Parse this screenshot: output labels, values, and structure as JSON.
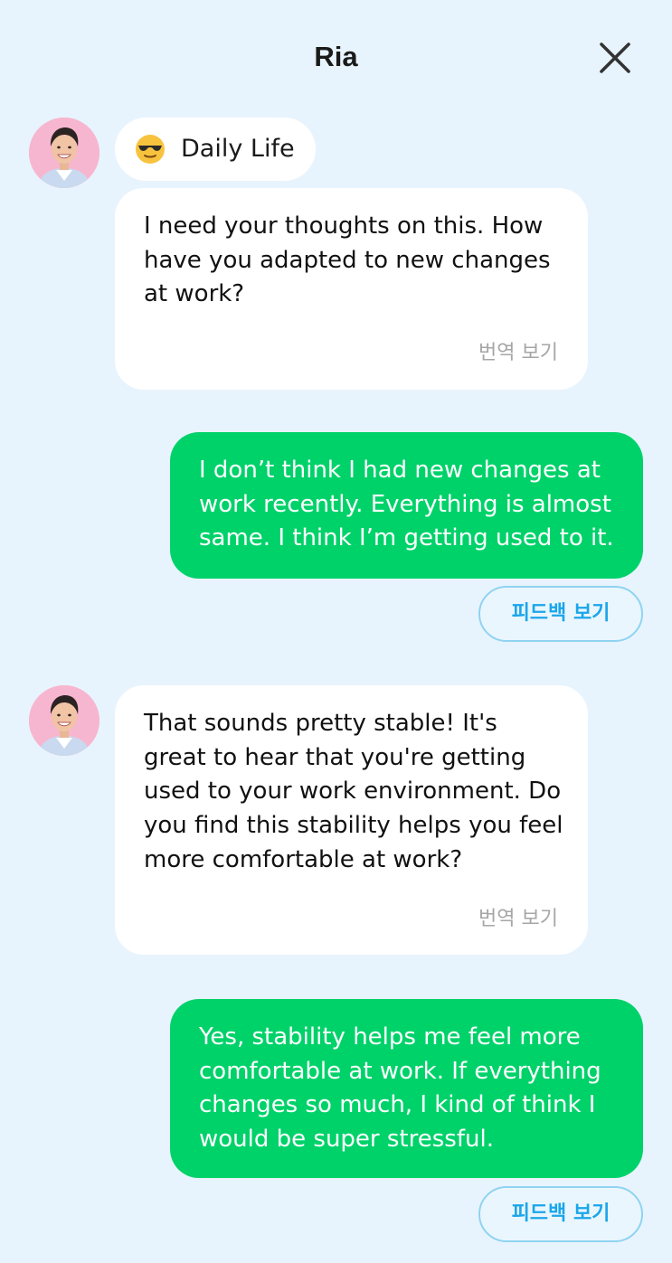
{
  "header": {
    "title": "Ria"
  },
  "topic": {
    "emoji": "😎",
    "label": "Daily Life"
  },
  "messages": [
    {
      "sender": "ai",
      "text": "I need your thoughts on this. How\nhave you adapted to new changes\nat work?",
      "translate_label": "번역 보기"
    },
    {
      "sender": "user",
      "text": "I don’t think I had new changes at\nwork recently. Everything is almost\nsame. I think I’m getting used to it.",
      "feedback_label": "피드백 보기"
    },
    {
      "sender": "ai",
      "text": "That sounds pretty stable! It's\ngreat to hear that you're getting\nused to your work environment. Do\nyou find this stability helps you feel\nmore comfortable at work?",
      "translate_label": "번역 보기"
    },
    {
      "sender": "user",
      "text": "Yes, stability helps me feel more\ncomfortable at work. If everything\nchanges so much, I kind of think I\nwould be super stressful.",
      "feedback_label": "피드백 보기"
    }
  ],
  "colors": {
    "background": "#e8f4fd",
    "user_bubble": "#00d26a",
    "ai_bubble": "#ffffff",
    "feedback_text": "#1ba6ea",
    "feedback_border": "#8fd3f2",
    "translate_text": "#a6a6a6"
  },
  "icons": {
    "close": "close-icon",
    "topic": "sunglasses-emoji-icon",
    "avatar": "ria-avatar"
  }
}
